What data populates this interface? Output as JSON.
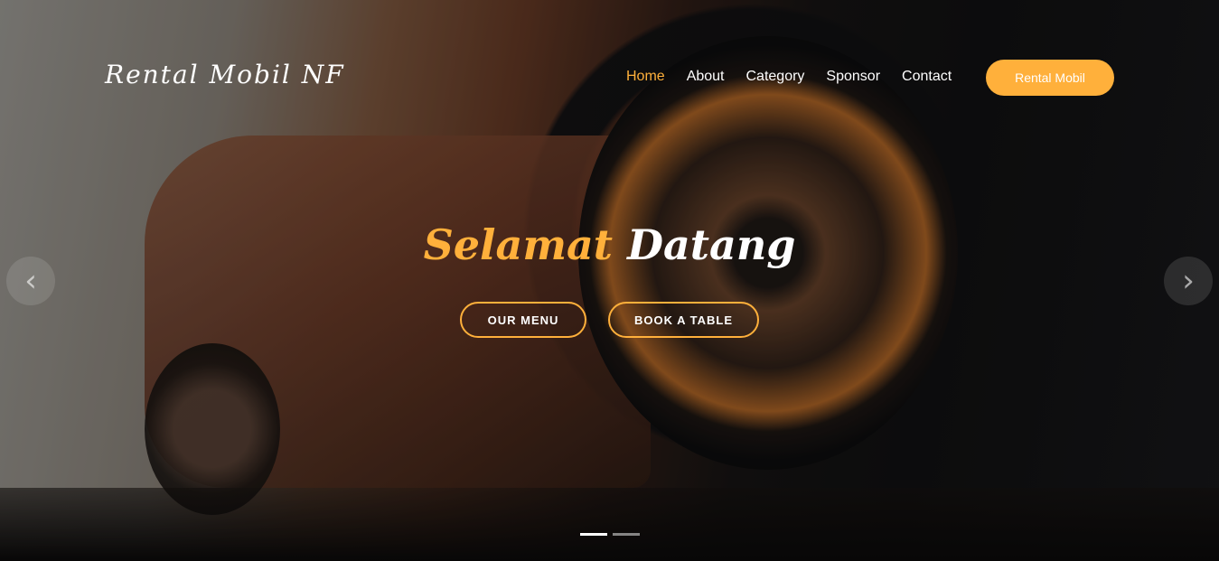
{
  "brand": {
    "logo_text": "Rental Mobil NF"
  },
  "nav": {
    "items": [
      {
        "label": "Home",
        "active": true
      },
      {
        "label": "About",
        "active": false
      },
      {
        "label": "Category",
        "active": false
      },
      {
        "label": "Sponsor",
        "active": false
      },
      {
        "label": "Contact",
        "active": false
      }
    ],
    "cta_label": "Rental Mobil"
  },
  "hero": {
    "headline_part1": "Selamat",
    "headline_part2": "Datang",
    "button_menu": "OUR MENU",
    "button_book": "BOOK A TABLE",
    "arrow_prev_icon": "chevron-left-icon",
    "arrow_next_icon": "chevron-right-icon",
    "slides_total": 2,
    "active_slide": 1
  },
  "colors": {
    "accent": "#ffb03b",
    "text": "#ffffff"
  }
}
